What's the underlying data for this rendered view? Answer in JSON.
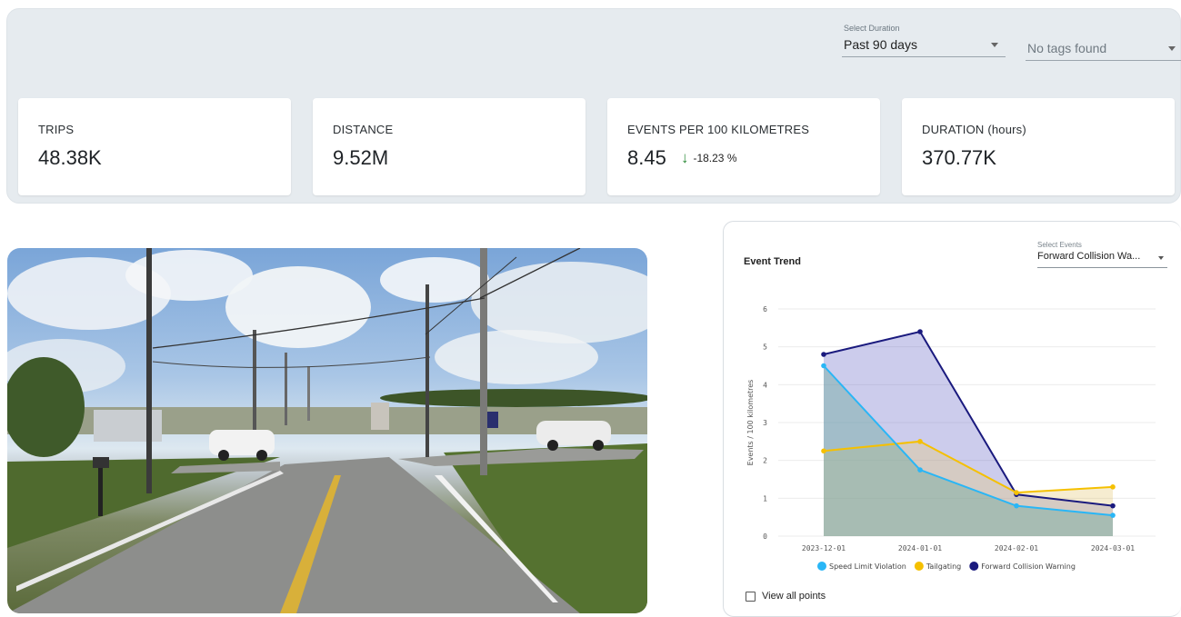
{
  "filters": {
    "duration_caption": "Select Duration",
    "duration_value": "Past 90 days",
    "tags_value": "No tags found"
  },
  "kpis": [
    {
      "label": "TRIPS",
      "value": "48.38K"
    },
    {
      "label": "DISTANCE",
      "value": "9.52M"
    },
    {
      "label": "EVENTS PER 100 KILOMETRES",
      "value": "8.45",
      "change": "-18.23 %",
      "change_direction": "down",
      "change_color": "#2e8b3a"
    },
    {
      "label": "DURATION (hours)",
      "value": "370.77K"
    }
  ],
  "chart_card": {
    "title": "Event Trend",
    "events_caption": "Select Events",
    "events_value": "Forward Collision Wa...",
    "view_all_label": "View all points"
  },
  "chart_data": {
    "type": "area",
    "title": "Event Trend",
    "xlabel": "",
    "ylabel": "Events / 100 kilometres",
    "categories": [
      "2023-12-01",
      "2024-01-01",
      "2024-02-01",
      "2024-03-01"
    ],
    "ylim": [
      0,
      6
    ],
    "yticks": [
      0,
      1,
      2,
      3,
      4,
      5,
      6
    ],
    "grid": true,
    "legend_position": "bottom",
    "series": [
      {
        "name": "Speed Limit Violation",
        "color": "#29b6f6",
        "values": [
          4.5,
          1.75,
          0.8,
          0.55
        ]
      },
      {
        "name": "Tailgating",
        "color": "#f5c000",
        "values": [
          2.25,
          2.5,
          1.15,
          1.3
        ]
      },
      {
        "name": "Forward Collision Warning",
        "color": "#1a1a7e",
        "values": [
          4.8,
          5.4,
          1.1,
          0.8
        ]
      }
    ]
  }
}
